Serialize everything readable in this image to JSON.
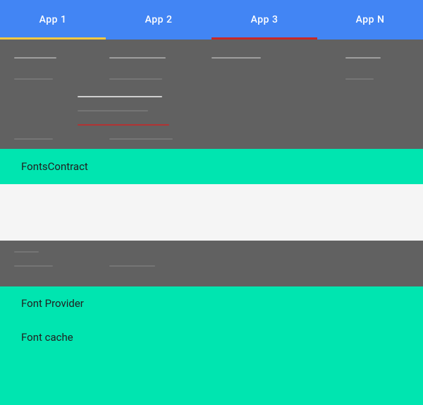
{
  "appBar": {
    "tabs": [
      {
        "id": "app1",
        "label": "App 1",
        "active": false
      },
      {
        "id": "app2",
        "label": "App 2",
        "active": true
      },
      {
        "id": "app3",
        "label": "App 3",
        "active": false
      },
      {
        "id": "appN",
        "label": "App N",
        "active": false
      }
    ]
  },
  "diagram": {
    "fontsContractLabel": "FontsContract",
    "fontProviderLabel": "Font Provider",
    "fontCacheLabel": "Font cache"
  },
  "colors": {
    "appBarBg": "#4285f4",
    "tealBg": "#00e5b0",
    "grayBg": "#616161",
    "white": "#ffffff",
    "tabIndicatorActive": "#f4c842",
    "tabIndicatorActive2": "#c62828"
  }
}
